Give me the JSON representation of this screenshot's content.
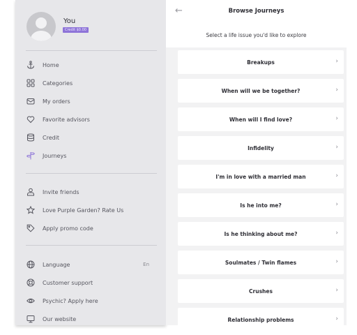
{
  "sidebar": {
    "profile": {
      "name": "You",
      "credit_badge": "Credit $0.00"
    },
    "primary": [
      {
        "label": "Home",
        "icon": "anchor-icon"
      },
      {
        "label": "Categories",
        "icon": "grid-icon"
      },
      {
        "label": "My orders",
        "icon": "envelope-icon"
      },
      {
        "label": "Favorite advisors",
        "icon": "heart-icon"
      },
      {
        "label": "Credit",
        "icon": "database-icon"
      },
      {
        "label": "Journeys",
        "icon": "signpost-icon"
      }
    ],
    "secondary": [
      {
        "label": "Invite friends",
        "icon": "user-icon"
      },
      {
        "label": "Love Purple Garden? Rate Us",
        "icon": "star-icon"
      },
      {
        "label": "Apply promo code",
        "icon": "tag-icon"
      }
    ],
    "tertiary": [
      {
        "label": "Language",
        "icon": "globe-icon",
        "value": "En"
      },
      {
        "label": "Customer support",
        "icon": "lifebuoy-icon"
      },
      {
        "label": "Psychic? Apply here",
        "icon": "eye-icon"
      },
      {
        "label": "Our website",
        "icon": "monitor-icon"
      }
    ],
    "active_item": "Journeys",
    "accent_color": "#8e74d8"
  },
  "main": {
    "title": "Browse Journeys",
    "subtitle": "Select a life issue you'd like to explore",
    "journeys": [
      {
        "label": "Breakups"
      },
      {
        "label": "When will we be together?"
      },
      {
        "label": "When will I find love?"
      },
      {
        "label": "Infidelity"
      },
      {
        "label": "I'm in love with a married man"
      },
      {
        "label": "Is he into me?"
      },
      {
        "label": "Is he thinking about me?"
      },
      {
        "label": "Soulmates / Twin flames"
      },
      {
        "label": "Crushes"
      },
      {
        "label": "Relationship problems"
      }
    ]
  }
}
